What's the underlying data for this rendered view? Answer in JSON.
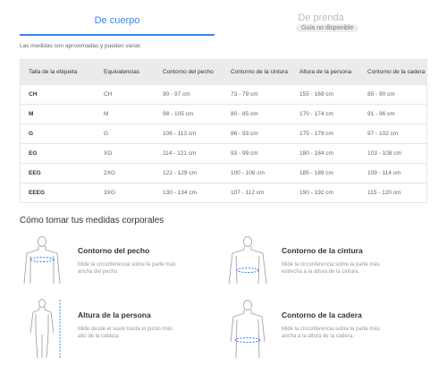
{
  "tabs": {
    "body": "De cuerpo",
    "garment": "De prenda",
    "garment_badge": "Guía no disponible"
  },
  "note": "Las medidas son aproximadas y pueden variar.",
  "table": {
    "headers": [
      "Talla de la etiqueta",
      "Equivalencias",
      "Contorno del pecho",
      "Contorno de la cintura",
      "Altura de la persona",
      "Contorno de la cadera"
    ],
    "rows": [
      [
        "CH",
        "CH",
        "90 - 97 cm",
        "73 - 79 cm",
        "155 - 169 cm",
        "85 - 90 cm"
      ],
      [
        "M",
        "M",
        "98 - 105 cm",
        "80 - 85 cm",
        "170 - 174 cm",
        "91 - 96 cm"
      ],
      [
        "G",
        "G",
        "106 - 113 cm",
        "86 - 93 cm",
        "175 - 179 cm",
        "97 - 102 cm"
      ],
      [
        "EG",
        "XG",
        "114 - 121 cm",
        "93 - 99 cm",
        "180 - 184 cm",
        "103 - 108 cm"
      ],
      [
        "EEG",
        "2XG",
        "122 - 129 cm",
        "100 - 106 cm",
        "185 - 189 cm",
        "109 - 114 cm"
      ],
      [
        "EEEG",
        "3XG",
        "130 - 134 cm",
        "107 - 112 cm",
        "190 - 192 cm",
        "115 - 120 cm"
      ]
    ]
  },
  "how_to": {
    "title": "Cómo tomar tus medidas corporales",
    "items": [
      {
        "title": "Contorno del pecho",
        "desc": "Mide la circunferencia sobre la parte más ancha del pecho.",
        "icon": "chest-measure-icon"
      },
      {
        "title": "Contorno de la cintura",
        "desc": "Mide la circunferencia sobre la parte más estrecha a la altura de la cintura.",
        "icon": "waist-measure-icon"
      },
      {
        "title": "Altura de la persona",
        "desc": "Mide desde el suelo hasta el punto más alto de la cabeza.",
        "icon": "height-measure-icon"
      },
      {
        "title": "Contorno de la cadera",
        "desc": "Mide la circunferencia sobre la parte más ancha a la altura de la cadera.",
        "icon": "hip-measure-icon"
      }
    ]
  },
  "colors": {
    "accent": "#3483fa",
    "header_bg": "#ebebeb"
  }
}
